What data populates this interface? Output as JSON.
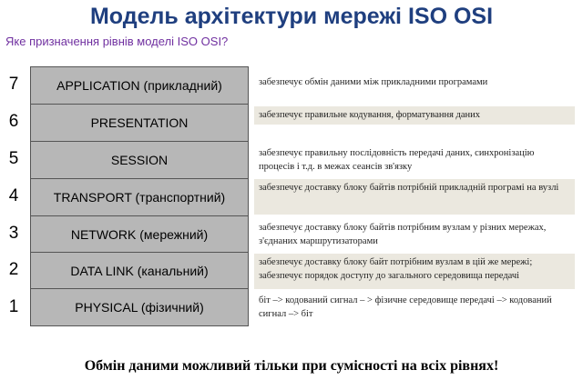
{
  "title": "Модель архітектури мережі ISO OSI",
  "subtitle": "Яке призначення рівнів моделі ISO OSI?",
  "layers": [
    {
      "num": "7",
      "name": "APPLICATION  (прикладний)",
      "desc": "забезпечує  обмін даними між прикладними програмами"
    },
    {
      "num": "6",
      "name": "PRESENTATION",
      "desc": "забезпечує правильне кодування, форматування даних"
    },
    {
      "num": "5",
      "name": "SESSION",
      "desc": "забезпечує правильну послідовність передачі даних, синхронізацію процесів і т.д. в межах сеансів зв'язку"
    },
    {
      "num": "4",
      "name": "TRANSPORT  (транспортний)",
      "desc": "забезпечує доставку блоку байтів потрібній прикладній програмі на вузлі"
    },
    {
      "num": "3",
      "name": "NETWORK  (мережний)",
      "desc": "забезпечує доставку блоку байтів потрібним вузлам у різних мережах, з'єднаних маршрутизаторами"
    },
    {
      "num": "2",
      "name": "DATA LINK  (канальний)",
      "desc": "забезпечує доставку блоку байт потрібним вузлам в цій же мережі; забезпечує порядок доступу до загального середовища передачі"
    },
    {
      "num": "1",
      "name": "PHYSICAL  (фізичний)",
      "desc": "біт –> кодований сигнал – > фізичне  середовище передачі –> кодований сигнал –> біт"
    }
  ],
  "footer": "Обмін даними можливий тільки при сумісності на всіх рівнях!"
}
